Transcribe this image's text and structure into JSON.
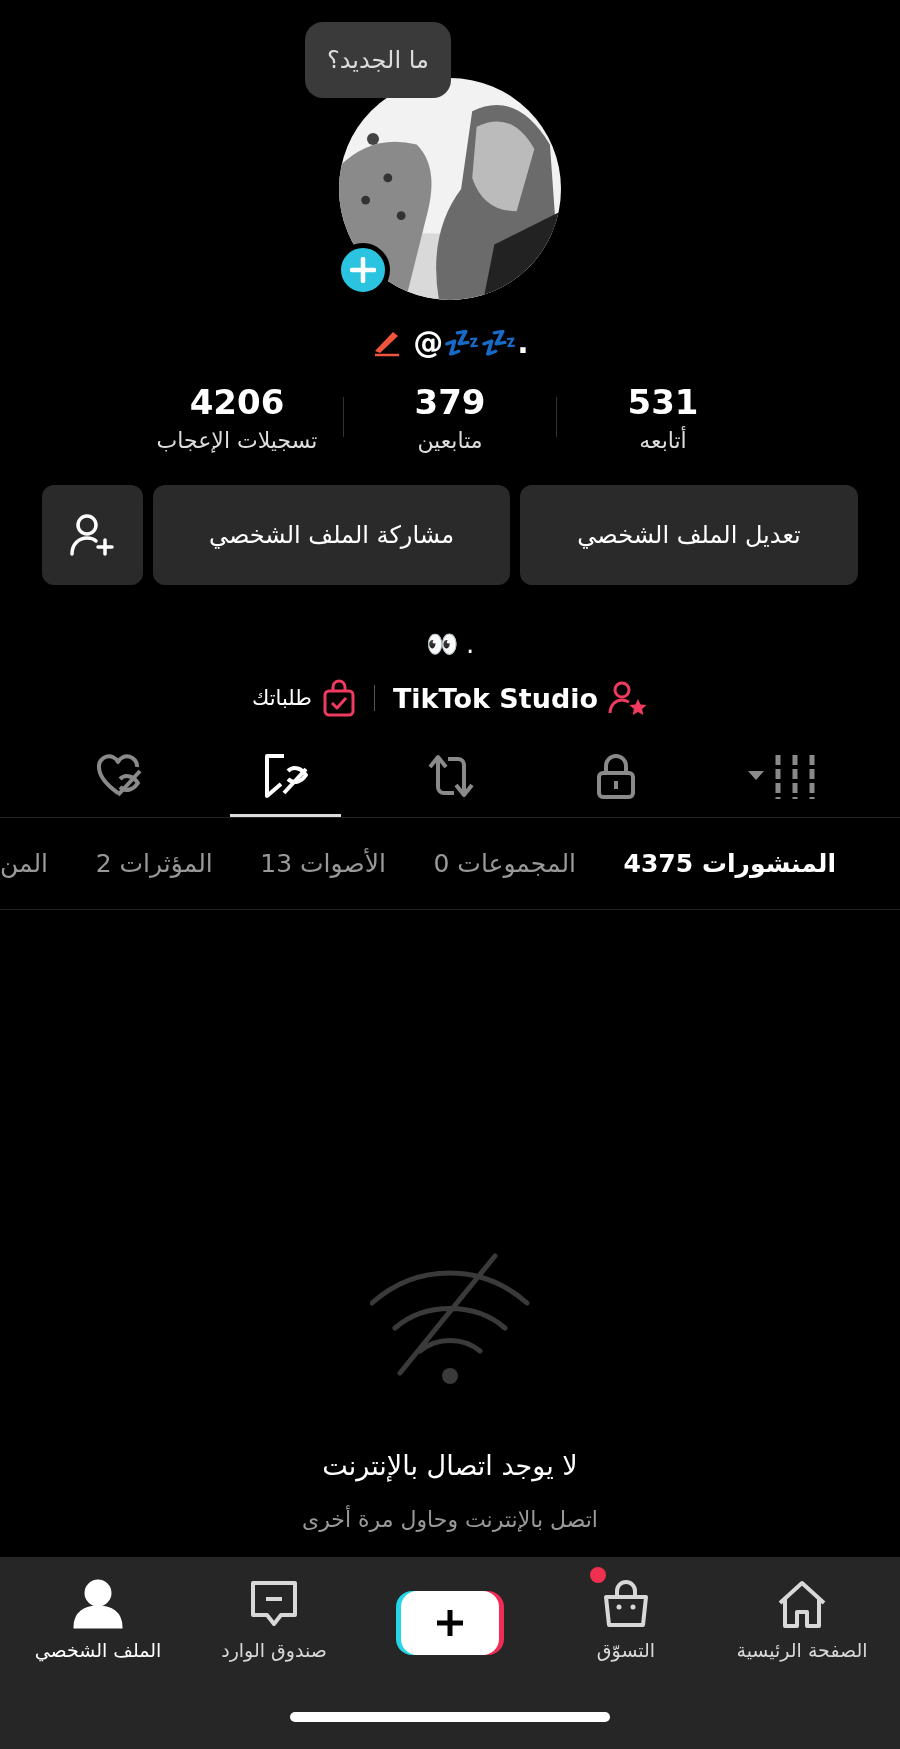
{
  "bubble": {
    "text": "ما الجديد؟"
  },
  "username": "@💤💤.",
  "stats": [
    {
      "value": "531",
      "label": "أتابعه"
    },
    {
      "value": "379",
      "label": "متابعين"
    },
    {
      "value": "4206",
      "label": "تسجيلات الإعجاب"
    }
  ],
  "buttons": [
    {
      "kind": "text",
      "label": "تعديل الملف الشخصي"
    },
    {
      "kind": "text",
      "label": "مشاركة الملف الشخصي"
    },
    {
      "kind": "add-friend"
    }
  ],
  "bio": "👀 .",
  "links": [
    {
      "kind": "studio",
      "label": "TikTok Studio"
    },
    {
      "kind": "orders",
      "label": "طلباتك"
    }
  ],
  "content_tabs": [
    {
      "kind": "grid",
      "selected": false
    },
    {
      "kind": "lock",
      "selected": false
    },
    {
      "kind": "repost",
      "selected": false
    },
    {
      "kind": "bookmark",
      "selected": true
    },
    {
      "kind": "liked",
      "selected": false
    }
  ],
  "filters": [
    {
      "label": "المنشورات",
      "count": "4375",
      "selected": true
    },
    {
      "label": "المجموعات",
      "count": "0",
      "selected": false
    },
    {
      "label": "الأصوات",
      "count": "13",
      "selected": false
    },
    {
      "label": "المؤثرات",
      "count": "2",
      "selected": false
    },
    {
      "label": "المن",
      "selected": false
    }
  ],
  "empty_state": {
    "title": "لا يوجد اتصال بالإنترنت",
    "message": "اتصل بالإنترنت وحاول مرة أخرى"
  },
  "nav": [
    {
      "kind": "home",
      "label": "الصفحة الرئيسية",
      "selected": false
    },
    {
      "kind": "shop",
      "label": "التسوّق",
      "selected": false,
      "badge": true
    },
    {
      "kind": "create"
    },
    {
      "kind": "inbox",
      "label": "صندوق الوارد",
      "selected": false
    },
    {
      "kind": "profile",
      "label": "الملف الشخصي",
      "selected": true
    }
  ]
}
